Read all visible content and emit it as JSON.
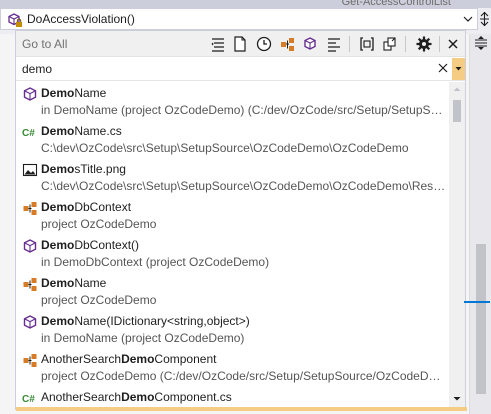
{
  "topbar": {
    "tab_text": "Get-AccessControlList",
    "member_name": "DoAccessViolation()",
    "member_icon": "method-lock-icon"
  },
  "popup": {
    "title": "Go to All",
    "toolbar_icons": [
      "filter-lines-icon",
      "file-icon",
      "clock-icon",
      "class-icon",
      "cube-icon",
      "align-icon",
      "bracket-icon",
      "pin-icon",
      "gear-icon",
      "close-icon"
    ]
  },
  "search": {
    "value": "demo",
    "placeholder": ""
  },
  "results": [
    {
      "icon": "method-icon",
      "match": "Demo",
      "rest": "Name",
      "detail": "in DemoName (project OzCodeDemo) (C:/dev/OzCode/src/Setup/SetupSource/OzCodeDemo/OzCodeDemo/DemoName.cs)"
    },
    {
      "icon": "csharp-file-icon",
      "match": "Demo",
      "rest": "Name.cs",
      "detail": "C:\\dev\\OzCode\\src\\Setup\\SetupSource\\OzCodeDemo\\OzCodeDemo"
    },
    {
      "icon": "image-file-icon",
      "match": "Demo",
      "rest": "sTitle.png",
      "detail": "C:\\dev\\OzCode\\src\\Setup\\SetupSource\\OzCodeDemo\\OzCodeDemo\\Resources"
    },
    {
      "icon": "class-icon",
      "match": "Demo",
      "rest": "DbContext",
      "detail": "project OzCodeDemo"
    },
    {
      "icon": "method-icon",
      "match": "Demo",
      "rest": "DbContext()",
      "detail": "in DemoDbContext (project OzCodeDemo)"
    },
    {
      "icon": "class-icon",
      "match": "Demo",
      "rest": "Name",
      "detail": "project OzCodeDemo"
    },
    {
      "icon": "method-icon",
      "match": "Demo",
      "rest": "Name(IDictionary<string,object>)",
      "detail": "in DemoName (project OzCodeDemo)"
    },
    {
      "icon": "class-icon",
      "prefix": "AnotherSearch",
      "match": "Demo",
      "rest": "Component",
      "detail": "project OzCodeDemo (C:/dev/OzCode/src/Setup/SetupSource/OzCodeDemo/OzCodeDemo/AnotherSearchDemoComponent.cs)"
    },
    {
      "icon": "csharp-file-icon",
      "prefix": "AnotherSearch",
      "match": "Demo",
      "rest": "Component.cs",
      "detail": ""
    }
  ],
  "colors": {
    "accent": "#f5cc84",
    "method_purple": "#652d90",
    "class_orange": "#d67b26",
    "csharp_green": "#388a34",
    "scroll_marker": "#0078d7"
  }
}
